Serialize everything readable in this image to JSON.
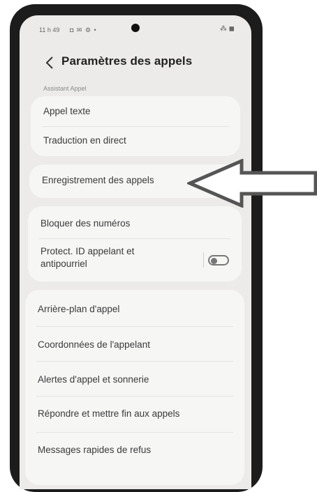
{
  "status_bar": {
    "time": "11 h 49",
    "icons": "◘ ✉ ⚙ •",
    "right": "⁂ ◼"
  },
  "header": {
    "title": "Paramètres des appels"
  },
  "sections": {
    "assistant_label": "Assistant Appel"
  },
  "cards": [
    {
      "items": [
        "Appel texte",
        "Traduction en direct"
      ]
    },
    {
      "items": [
        "Enregistrement des appels"
      ]
    },
    {
      "items": [
        "Bloquer des numéros",
        "Protect. ID appelant et antipourriel"
      ]
    },
    {
      "items": [
        "Arrière-plan d'appel",
        "Coordonnées de l'appelant",
        "Alertes d'appel et sonnerie",
        "Répondre et mettre fin aux appels",
        "Messages rapides de refus"
      ]
    }
  ],
  "toggles": {
    "caller_id_protection": false
  },
  "colors": {
    "arrow_stroke": "#555555",
    "arrow_fill": "#ffffff"
  }
}
